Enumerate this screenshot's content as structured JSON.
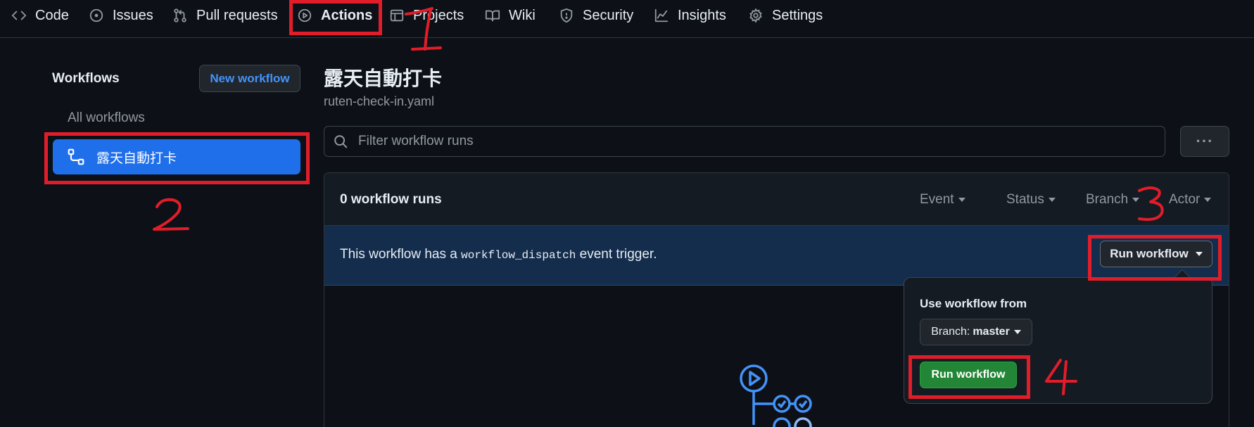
{
  "nav": {
    "tabs": [
      {
        "label": "Code",
        "icon": "code-icon"
      },
      {
        "label": "Issues",
        "icon": "issue-opened-icon"
      },
      {
        "label": "Pull requests",
        "icon": "git-pull-request-icon"
      },
      {
        "label": "Actions",
        "icon": "play-icon",
        "active": true
      },
      {
        "label": "Projects",
        "icon": "table-icon"
      },
      {
        "label": "Wiki",
        "icon": "book-icon"
      },
      {
        "label": "Security",
        "icon": "shield-icon"
      },
      {
        "label": "Insights",
        "icon": "graph-icon"
      },
      {
        "label": "Settings",
        "icon": "gear-icon"
      }
    ]
  },
  "sidebar": {
    "title": "Workflows",
    "new_workflow_label": "New workflow",
    "all_workflows_label": "All workflows",
    "items": [
      {
        "label": "露天自動打卡",
        "icon": "workflow-icon",
        "selected": true
      }
    ]
  },
  "main": {
    "title": "露天自動打卡",
    "filename": "ruten-check-in.yaml",
    "filter_placeholder": "Filter workflow runs",
    "more_label": "···",
    "runs_count": "0 workflow runs",
    "filters": [
      "Event",
      "Status",
      "Branch",
      "Actor"
    ],
    "dispatch": {
      "before": "This workflow has a ",
      "code": "workflow_dispatch",
      "after": " event trigger.",
      "run_button_label": "Run workflow"
    },
    "dropdown": {
      "label": "Use workflow from",
      "branch_prefix": "Branch:",
      "branch_value": "master",
      "run_label": "Run workflow"
    }
  },
  "annotations": {
    "step_numbers": [
      "1",
      "2",
      "3",
      "4"
    ],
    "color": "#e11d2a"
  },
  "colors": {
    "background": "#0d1117",
    "accent_blue": "#1f6feb",
    "link_blue": "#4493f8",
    "green": "#238636",
    "dispatch_bg": "#142d4c"
  }
}
